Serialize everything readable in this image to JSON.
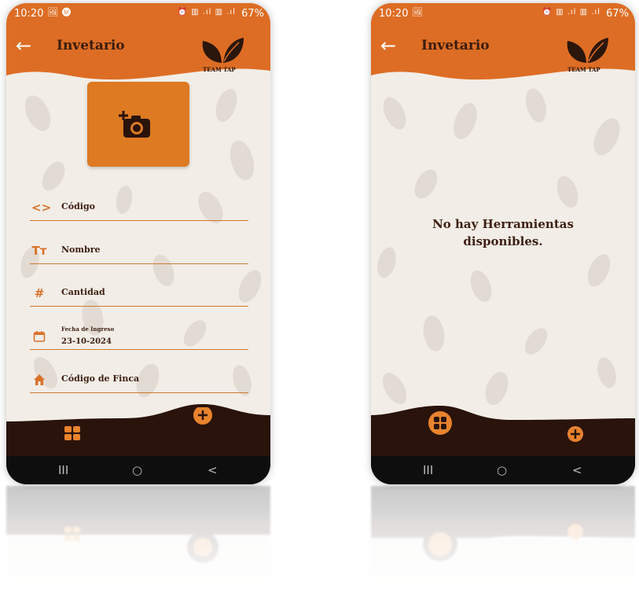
{
  "status_bar_left": {
    "time": "10:20",
    "left_icons": "🖼 Ⓜ",
    "right_icons": "⏰ ▥ .ıl ▥ .ıl",
    "battery": "67%"
  },
  "status_bar_right": {
    "time": "10:20",
    "left_icons": "🖼",
    "right_icons": "⏰ ▥ .ıl ▥ .ıl",
    "battery": "67%"
  },
  "header": {
    "title": "Invetario",
    "logo_text": "TEAM TAP"
  },
  "form": {
    "fields": [
      {
        "icon": "code-icon",
        "label": "Código"
      },
      {
        "icon": "text-icon",
        "label": "Nombre"
      },
      {
        "icon": "hash-icon",
        "label": "Cantidad"
      },
      {
        "icon": "calendar-icon",
        "label": "Fecha de Ingreso",
        "value": "23-10-2024"
      },
      {
        "icon": "home-icon",
        "label": "Código de Finca"
      }
    ]
  },
  "empty_state": {
    "message_line1": "No hay Herramientas",
    "message_line2": "disponibles."
  },
  "icons": {
    "code": "<>",
    "text": "Tт",
    "hash": "#",
    "back": "←"
  },
  "system_nav": {
    "recents": "III",
    "home": "○",
    "back": "<"
  },
  "colors": {
    "orange": "#dd6d24",
    "dark_brown": "#2a130b",
    "background": "#f2ede7",
    "text": "#3d2013"
  }
}
